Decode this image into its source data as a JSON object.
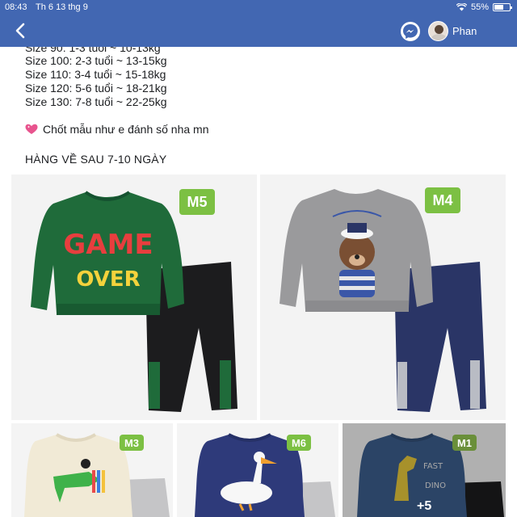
{
  "status": {
    "time": "08:43",
    "date": "Th 6 13 thg 9",
    "battery": "55%",
    "battery_level": 0.55
  },
  "nav": {
    "user_name": "Phan"
  },
  "post": {
    "cut_line": "Size 90: 1-3 tuổi ~ 10-13kg",
    "size_lines": [
      "Size 100: 2-3 tuổi ~ 13-15kg",
      "Size 110: 3-4 tuổi ~ 15-18kg",
      "Size 120: 5-6 tuổi ~ 18-21kg",
      "Size 130: 7-8 tuổi ~ 22-25kg"
    ],
    "chot": "Chốt mẫu như e đánh số nha mn",
    "hang_ve": "HÀNG VỀ SAU 7-10 NGÀY"
  },
  "photos": [
    {
      "badge": "M5",
      "shirt_text_1": "GAME",
      "shirt_text_2": "OVER",
      "shirt_color": "#1f6b3a",
      "pants_color": "#1c1c1e"
    },
    {
      "badge": "M4",
      "shirt_color": "#9a9a9c",
      "pants_color": "#2a3566"
    },
    {
      "badge": "M3",
      "shirt_color": "#f1ead6"
    },
    {
      "badge": "M6",
      "shirt_color": "#2e3a7a"
    },
    {
      "badge": "M1",
      "shirt_color": "#3c5f8e",
      "shirt_text_1": "FAST",
      "shirt_text_2": "DINO",
      "more": "+5"
    }
  ]
}
